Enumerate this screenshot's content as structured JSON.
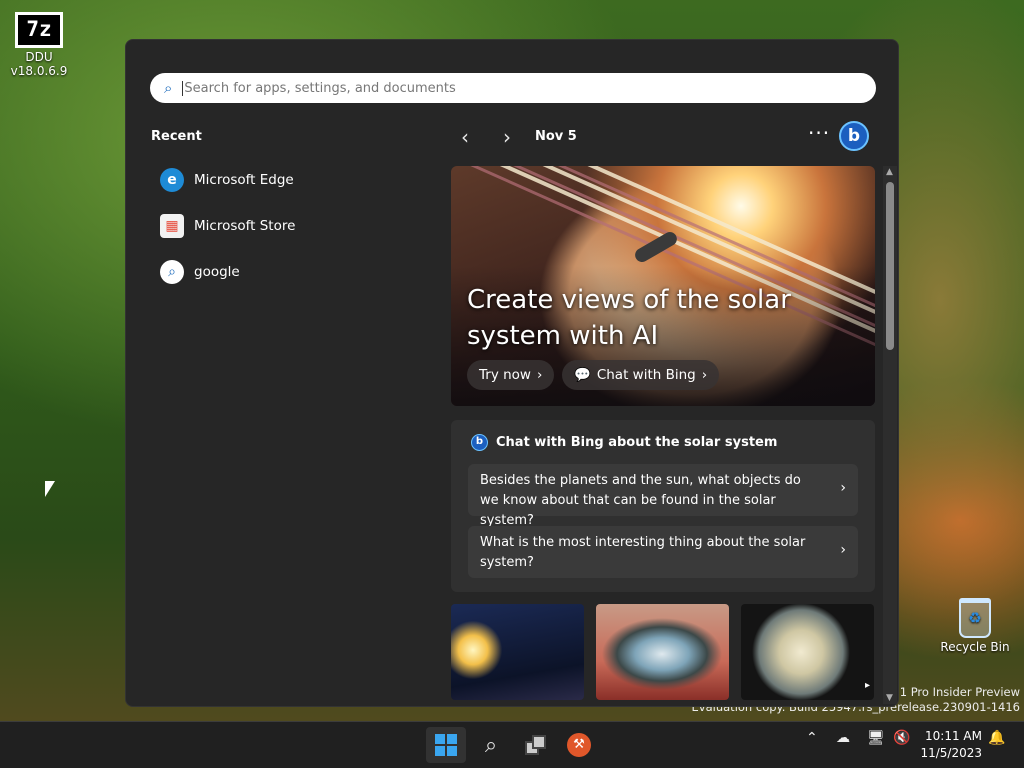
{
  "desktop": {
    "icons": {
      "ddu": {
        "label": "DDU v18.0.6.9",
        "glyph": "7z"
      },
      "recycle": {
        "label": "Recycle Bin",
        "glyph": "♻"
      }
    },
    "watermark": {
      "line1": "s 11 Pro Insider Preview",
      "line2": "Evaluation copy. Build 25947.rs_prerelease.230901-1416"
    }
  },
  "search": {
    "placeholder": "Search for apps, settings, and documents",
    "icon": "search-icon"
  },
  "recent": {
    "heading": "Recent",
    "items": [
      {
        "label": "Microsoft Edge",
        "icon": "edge-icon",
        "glyph": "e"
      },
      {
        "label": "Microsoft Store",
        "icon": "store-icon",
        "glyph": "▦"
      },
      {
        "label": "google",
        "icon": "search-icon",
        "glyph": "⌕"
      }
    ]
  },
  "highlights": {
    "date": "Nov 5",
    "more": "···",
    "bing": "b",
    "hero": {
      "title": "Create views of the solar system with AI",
      "try_now": "Try now",
      "chat": "Chat with Bing"
    },
    "card": {
      "title": "Chat with Bing about the solar system",
      "q1": "Besides the planets and the sun, what objects do we know about that can be found in the solar system?",
      "q2": "What is the most interesting thing about the solar system?"
    }
  },
  "taskbar": {
    "time": "10:11 AM",
    "date": "11/5/2023"
  },
  "colors": {
    "accent": "#3aa6f0",
    "bing_blue": "#1c5fbf",
    "panel": "#262626",
    "notification": "#e74c3c",
    "tile_orange": "#e0572a"
  }
}
